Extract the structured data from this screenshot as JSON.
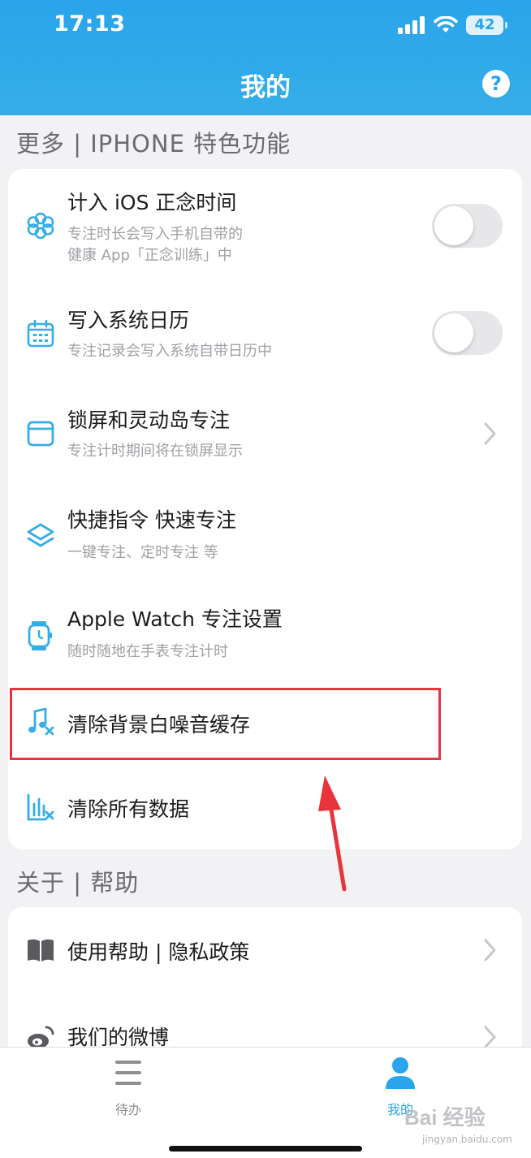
{
  "status_bar": {
    "time": "17:13",
    "battery": "42"
  },
  "nav": {
    "title": "我的",
    "help_icon": "question-circle-icon"
  },
  "sections": {
    "more": "更多 | IPHONE 特色功能",
    "about": "关于 | 帮助"
  },
  "more_items": [
    {
      "title": "计入 iOS 正念时间",
      "subtitle": "专注时长会写入手机自带的\n健康 App「正念训练」中",
      "icon": "flower-icon",
      "control": "toggle",
      "toggle_on": false
    },
    {
      "title": "写入系统日历",
      "subtitle": "专注记录会写入系统自带日历中",
      "icon": "calendar-icon",
      "control": "toggle",
      "toggle_on": false
    },
    {
      "title": "锁屏和灵动岛专注",
      "subtitle": "专注计时期间将在锁屏显示",
      "icon": "lockscreen-icon",
      "control": "chevron"
    },
    {
      "title": "快捷指令 快速专注",
      "subtitle": "一键专注、定时专注 等",
      "icon": "layers-icon",
      "control": "none"
    },
    {
      "title": "Apple Watch 专注设置",
      "subtitle": "随时随地在手表专注计时",
      "icon": "watch-icon",
      "control": "none"
    },
    {
      "title": "清除背景白噪音缓存",
      "icon": "music-clear-icon",
      "control": "none"
    },
    {
      "title": "清除所有数据",
      "icon": "chart-clear-icon",
      "control": "none"
    }
  ],
  "about_items": [
    {
      "title": "使用帮助 | 隐私政策",
      "icon": "book-icon",
      "control": "chevron"
    },
    {
      "title": "我们的微博",
      "icon": "weibo-icon",
      "control": "chevron"
    }
  ],
  "tabbar": {
    "todo_label": "待办",
    "mine_label": "我的",
    "active_color": "#2aa4ea",
    "inactive_color": "#8e8e93"
  },
  "annotation_color": "#e8343a",
  "accent_color": "#2aa4ea",
  "watermark": {
    "main": "Bai 经验",
    "sub": "jingyan.baidu.com"
  }
}
